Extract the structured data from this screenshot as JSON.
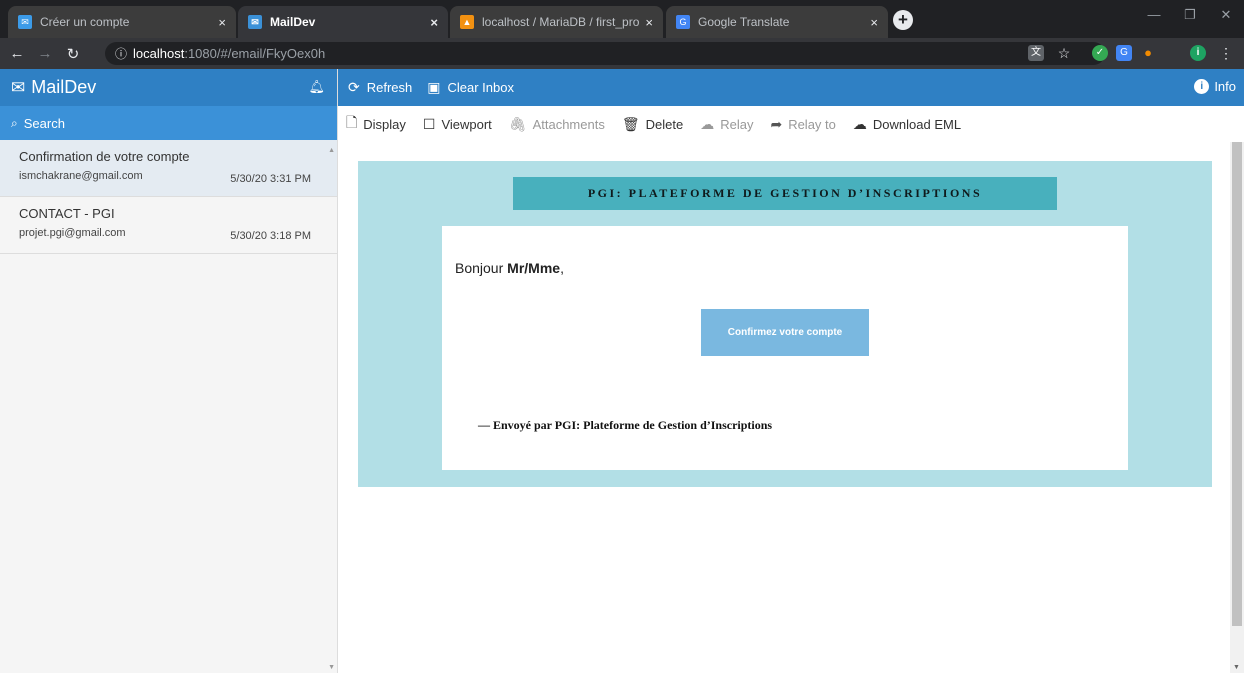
{
  "browser": {
    "tabs": [
      {
        "title": "Créer un compte",
        "close": "×",
        "favicon_color": "#3c9be8"
      },
      {
        "title": "MailDev",
        "close": "",
        "favicon_color": "#3b91d8"
      },
      {
        "title": "localhost / MariaDB / first_proj /",
        "close": "×",
        "favicon_color": "#f29111"
      },
      {
        "title": "Google Translate",
        "close": "×",
        "favicon_color": "#4285f4"
      }
    ],
    "active_tab_close": "×",
    "new_tab": "+",
    "url_host": "localhost",
    "url_rest": ":1080/#/email/FkyOex0h",
    "profile_initial": "i"
  },
  "maildev": {
    "brand": "MailDev",
    "search_label": "Search",
    "mails": [
      {
        "subject": "Confirmation de votre compte",
        "from": "ismchakrane@gmail.com",
        "date": "5/30/20 3:31 PM"
      },
      {
        "subject": "CONTACT - PGI",
        "from": "projet.pgi@gmail.com",
        "date": "5/30/20 3:18 PM"
      }
    ],
    "topbar": {
      "refresh": "Refresh",
      "clear_inbox": "Clear Inbox",
      "info": "Info"
    },
    "toolbar": {
      "display": "Display",
      "viewport": "Viewport",
      "attachments": "Attachments",
      "delete": "Delete",
      "relay": "Relay",
      "relay_to": "Relay to",
      "download_eml": "Download EML"
    }
  },
  "email": {
    "banner": "PGI: PLATEFORME DE GESTION D’INSCRIPTIONS",
    "greeting_prefix": "Bonjour ",
    "greeting_name": "Mr/Mme",
    "greeting_suffix": ",",
    "confirm_button": "Confirmez votre compte",
    "signoff": "— Envoyé par PGI: Plateforme de Gestion d’Inscriptions"
  },
  "colors": {
    "accent": "#2f80c4",
    "frame": "#b2dfe6",
    "banner": "#48b0bd",
    "confirm": "#7ab8e0"
  }
}
